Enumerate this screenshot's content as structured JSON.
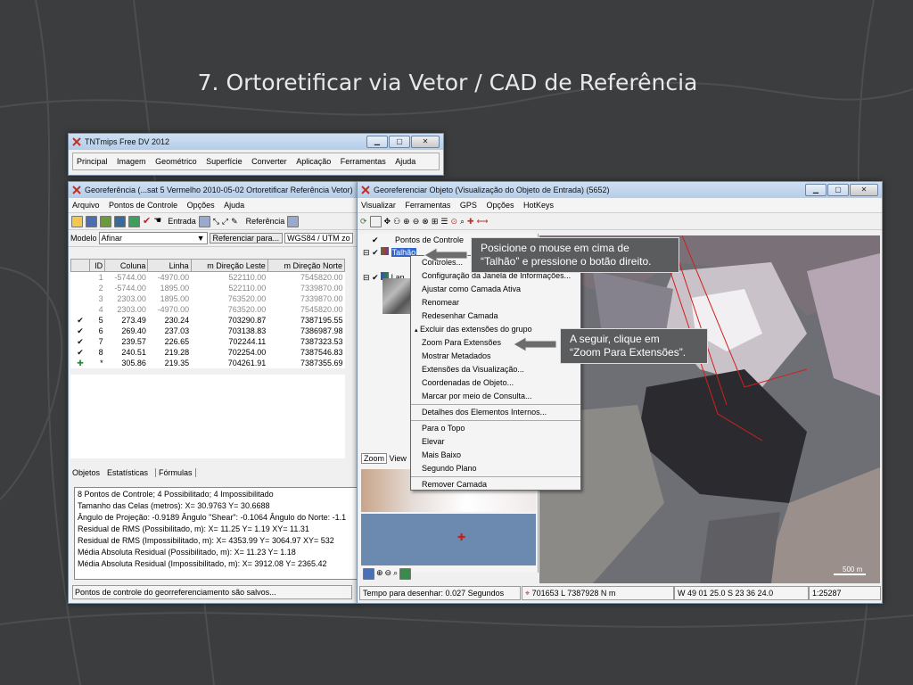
{
  "slide": {
    "title": "7. Ortoretificar via Vetor / CAD de Referência"
  },
  "main_window": {
    "title": "TNTmips Free DV 2012",
    "menu": [
      "Principal",
      "Imagem",
      "Geométrico",
      "Superfície",
      "Converter",
      "Aplicação",
      "Ferramentas",
      "Ajuda"
    ]
  },
  "geo_window": {
    "title": "Georeferência (...sat 5 Vermelho 2010-05-02 Ortoretificar Referência Vetor)",
    "menu": [
      "Arquivo",
      "Pontos de Controle",
      "Opções",
      "Ajuda"
    ],
    "toolbar_entrada": "Entrada",
    "toolbar_referencia": "Referência",
    "modelo_label": "Modelo",
    "modelo_value": "Afinar",
    "referenciar_button": "Referenciar para...",
    "projection": "WGS84 / UTM zo",
    "table": {
      "headers": [
        "ID",
        "Coluna",
        "Linha",
        "m Direção Leste",
        "m Direção Norte"
      ],
      "rows": [
        {
          "mark": "",
          "id": "1",
          "col": "-5744.00",
          "lin": "-4970.00",
          "east": "522110.00",
          "north": "7545820.00",
          "dim": true
        },
        {
          "mark": "",
          "id": "2",
          "col": "-5744.00",
          "lin": "1895.00",
          "east": "522110.00",
          "north": "7339870.00",
          "dim": true
        },
        {
          "mark": "",
          "id": "3",
          "col": "2303.00",
          "lin": "1895.00",
          "east": "763520.00",
          "north": "7339870.00",
          "dim": true
        },
        {
          "mark": "",
          "id": "4",
          "col": "2303.00",
          "lin": "-4970.00",
          "east": "763520.00",
          "north": "7545820.00",
          "dim": true
        },
        {
          "mark": "✔",
          "id": "5",
          "col": "273.49",
          "lin": "230.24",
          "east": "703290.87",
          "north": "7387195.55",
          "dim": false
        },
        {
          "mark": "✔",
          "id": "6",
          "col": "269.40",
          "lin": "237.03",
          "east": "703138.83",
          "north": "7386987.98",
          "dim": false
        },
        {
          "mark": "✔",
          "id": "7",
          "col": "239.57",
          "lin": "226.65",
          "east": "702244.11",
          "north": "7387323.53",
          "dim": false
        },
        {
          "mark": "✔",
          "id": "8",
          "col": "240.51",
          "lin": "219.28",
          "east": "702254.00",
          "north": "7387546.83",
          "dim": false
        },
        {
          "mark": "✚",
          "id": "*",
          "col": "305.86",
          "lin": "219.35",
          "east": "704261.91",
          "north": "7387355.69",
          "dim": false
        }
      ]
    },
    "tabs": [
      "Objetos",
      "Estatísticas",
      "Fórmulas"
    ],
    "stats": [
      "8 Pontos de Controle;  4 Possibilitado;  4 Impossibilitado",
      "Tamanho das Celas (metros):  X= 30.9763  Y= 30.6688",
      "Ângulo de Projeção: -0.9189  Ângulo \"Shear\": -0.1064  Ângulo do Norte: -1.1",
      "Residual de RMS (Possibilitado, m):  X= 11.25  Y= 1.19  XY= 11.31",
      "Residual de RMS (Impossibilitado, m):  X= 4353.99  Y= 3064.97  XY= 532",
      "Média Absoluta Residual (Possibilitado, m):  X= 11.23  Y= 1.18",
      "Média Absoluta Residual (Impossibilitado, m):  X= 3912.08  Y= 2365.42"
    ],
    "status": "Pontos de controle do georreferenciamento são salvos..."
  },
  "view_window": {
    "title": "Georeferenciar Objeto (Visualização do Objeto de Entrada) (5652)",
    "menu": [
      "Visualizar",
      "Ferramentas",
      "GPS",
      "Opções",
      "HotKeys"
    ],
    "layers_header": "Pontos de Controle",
    "layer1": "Talhão",
    "layer2": "Lan",
    "zoom_tab": "Zoom",
    "view_tab": "View",
    "draw_time": "Tempo para desenhar: 0.027 Segundos",
    "coords": "701653 L  7387928 N m",
    "latlon": "W 49 01 25.0  S 23 36 24.0",
    "scale": "1:25287",
    "scalebar": "500 m"
  },
  "context_menu": [
    "Controles...",
    "Configuração da Janela de Informações...",
    "Ajustar como Camada Ativa",
    "Renomear",
    "Redesenhar Camada",
    "Excluir das extensões do grupo",
    "Zoom Para Extensões",
    "Mostrar Metadados",
    "Extensões da Visualização...",
    "Coordenadas de Objeto...",
    "Marcar por meio de Consulta...",
    "Detalhes dos Elementos Internos...",
    "Para o Topo",
    "Elevar",
    "Mais Baixo",
    "Segundo Plano",
    "Remover Camada"
  ],
  "callouts": {
    "first": [
      "Posicione o mouse em cima de",
      "“Talhão” e pressione o botão direito."
    ],
    "second": [
      "A seguir, clique em",
      "“Zoom Para Extensões”."
    ]
  }
}
